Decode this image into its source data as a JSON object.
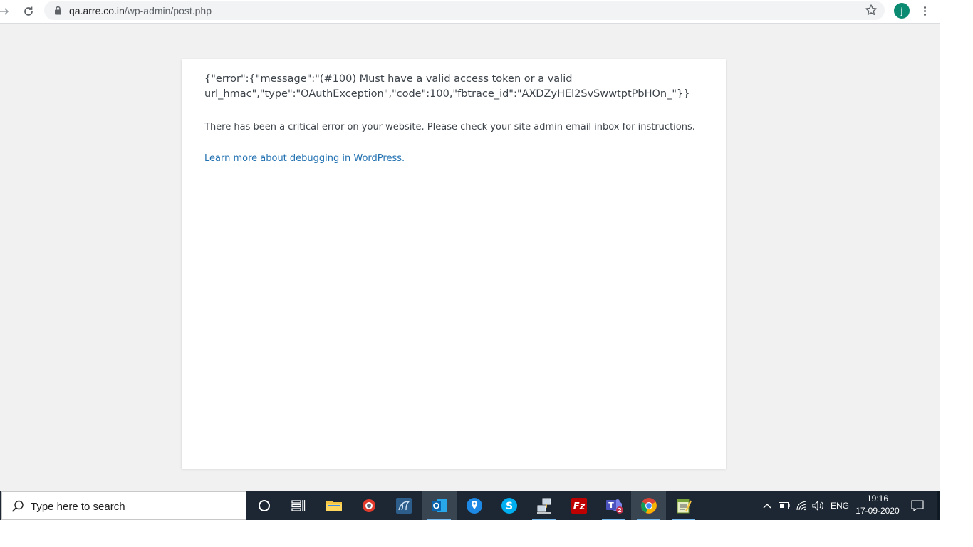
{
  "browser": {
    "url_host": "qa.arre.co.in",
    "url_path": "/wp-admin/post.php",
    "profile_initial": "j"
  },
  "page": {
    "error_json": "{\"error\":{\"message\":\"(#100) Must have a valid access token or a valid url_hmac\",\"type\":\"OAuthException\",\"code\":100,\"fbtrace_id\":\"AXDZyHEl2SvSwwtptPbHOn_\"}}",
    "critical_message": "There has been a critical error on your website. Please check your site admin email inbox for instructions.",
    "debug_link": "Learn more about debugging in WordPress."
  },
  "taskbar": {
    "search_placeholder": "Type here to search",
    "apps": [
      {
        "name": "cortana",
        "icon": "cortana-circle-icon"
      },
      {
        "name": "task-view",
        "icon": "task-view-icon"
      },
      {
        "name": "file-explorer",
        "icon": "folder-icon"
      },
      {
        "name": "settings-app",
        "icon": "red-globe-icon"
      },
      {
        "name": "mysql-workbench",
        "icon": "dolphin-icon"
      },
      {
        "name": "outlook",
        "icon": "outlook-icon"
      },
      {
        "name": "maps",
        "icon": "map-pin-icon"
      },
      {
        "name": "skype",
        "icon": "skype-icon"
      },
      {
        "name": "network-app",
        "icon": "network-icon"
      },
      {
        "name": "filezilla",
        "icon": "filezilla-icon"
      },
      {
        "name": "teams",
        "icon": "teams-icon",
        "badge": "2"
      },
      {
        "name": "chrome",
        "icon": "chrome-icon"
      },
      {
        "name": "notepad",
        "icon": "notepad-icon"
      }
    ],
    "language": "ENG",
    "time": "19:16",
    "date": "17-09-2020"
  },
  "colors": {
    "link": "#2271b1",
    "taskbar": "#1c2733",
    "page_bg": "#f1f1f1"
  }
}
